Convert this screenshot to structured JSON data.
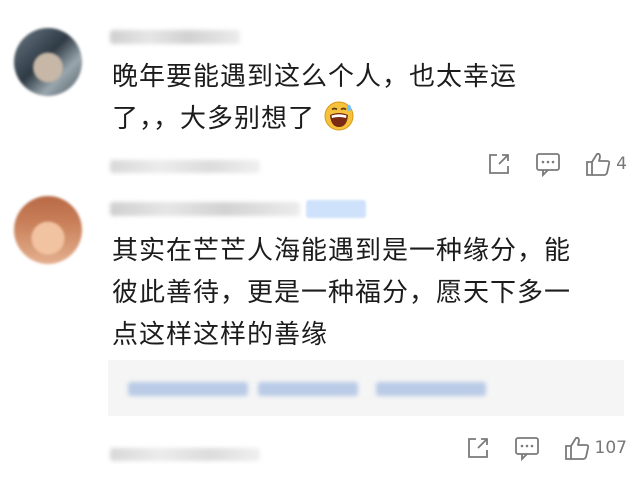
{
  "comments": [
    {
      "text_line1": "晚年要能遇到这么个人，也太幸运",
      "text_line2": "了，，大多别想了",
      "emoji": "grinning-sweat-emoji",
      "like_count": "4"
    },
    {
      "text_line1": "其实在芒芒人海能遇到是一种缘分，能",
      "text_line2": "彼此善待，更是一种福分，愿天下多一",
      "text_line3": "点这样这样的善缘",
      "like_count": "107"
    }
  ],
  "icons": {
    "share": "share-icon",
    "reply": "comment-icon",
    "like": "thumbs-up-icon"
  },
  "colors": {
    "text": "#1c1c1c",
    "meta": "#777777",
    "reply_bg": "#f5f5f5",
    "badge": "#cfe2fb"
  }
}
